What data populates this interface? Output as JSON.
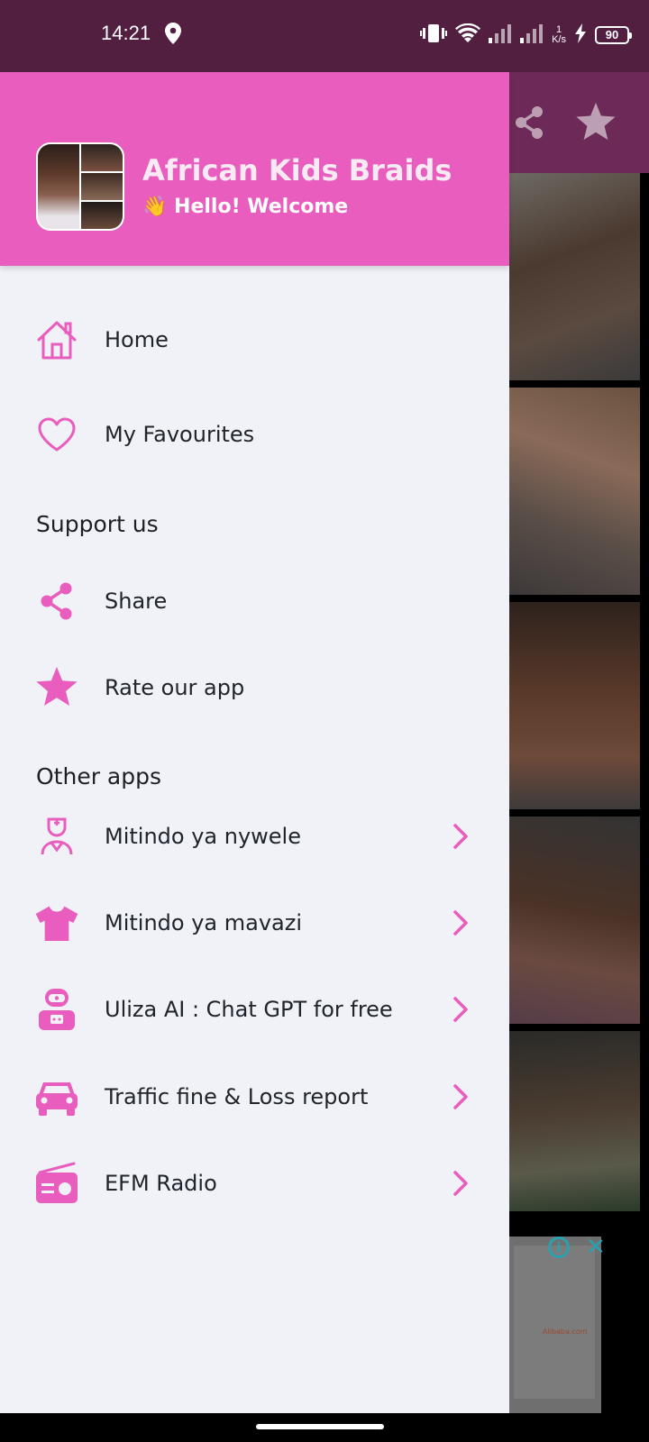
{
  "status_bar": {
    "time": "14:21",
    "net_speed_value": "1",
    "net_speed_unit": "K/s",
    "battery": "90"
  },
  "drawer": {
    "header": {
      "app_name": "African Kids Braids",
      "greeting": "👋 Hello! Welcome"
    },
    "main_items": [
      {
        "label": "Home",
        "icon": "home-icon"
      },
      {
        "label": "My Favourites",
        "icon": "heart-icon"
      }
    ],
    "support_section": {
      "title": "Support us",
      "items": [
        {
          "label": "Share",
          "icon": "share-icon"
        },
        {
          "label": "Rate our app",
          "icon": "star-icon"
        }
      ]
    },
    "other_apps_section": {
      "title": "Other apps",
      "items": [
        {
          "label": "Mitindo ya nywele",
          "icon": "hairdresser-icon"
        },
        {
          "label": "Mitindo ya mavazi",
          "icon": "tshirt-icon"
        },
        {
          "label": "Uliza AI : Chat GPT for free",
          "icon": "robot-icon"
        },
        {
          "label": "Traffic fine & Loss report",
          "icon": "car-icon"
        },
        {
          "label": "EFM Radio",
          "icon": "radio-icon"
        }
      ]
    }
  },
  "background_ad": {
    "brand": "Alibaba.com"
  },
  "colors": {
    "status_bar": "#521f40",
    "drawer_header": "#e85dbd",
    "accent_icon": "#e85dbd",
    "drawer_bg": "#f0f2f8",
    "text": "#20242c"
  }
}
